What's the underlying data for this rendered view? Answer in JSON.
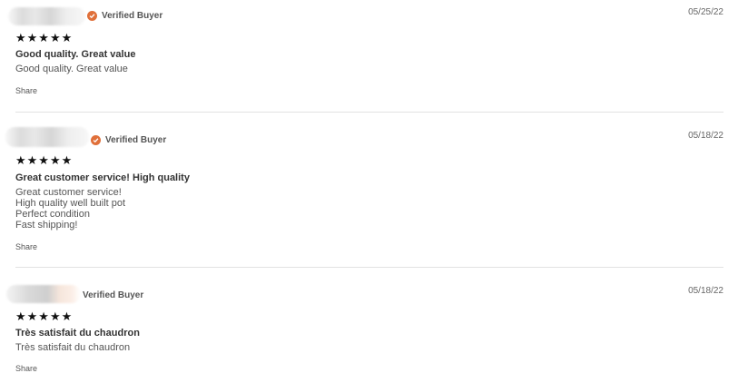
{
  "reviews": [
    {
      "badge": "Verified Buyer",
      "date": "05/25/22",
      "rating": 5,
      "stars": "★★★★★",
      "title": "Good quality. Great value",
      "body": [
        "Good quality. Great value"
      ],
      "share": "Share"
    },
    {
      "badge": "Verified Buyer",
      "date": "05/18/22",
      "rating": 5,
      "stars": "★★★★★",
      "title": "Great customer service! High quality",
      "body": [
        "Great customer service!",
        "High quality well built pot",
        "Perfect condition",
        "Fast shipping!"
      ],
      "share": "Share"
    },
    {
      "badge": "Verified Buyer",
      "date": "05/18/22",
      "rating": 5,
      "stars": "★★★★★",
      "title": "Très satisfait du chaudron",
      "body": [
        "Très satisfait du chaudron"
      ],
      "share": "Share"
    }
  ],
  "colors": {
    "verified_badge": "#e0703a"
  },
  "icons": {
    "verified": "check-circle-icon",
    "rating": "star-icon"
  }
}
